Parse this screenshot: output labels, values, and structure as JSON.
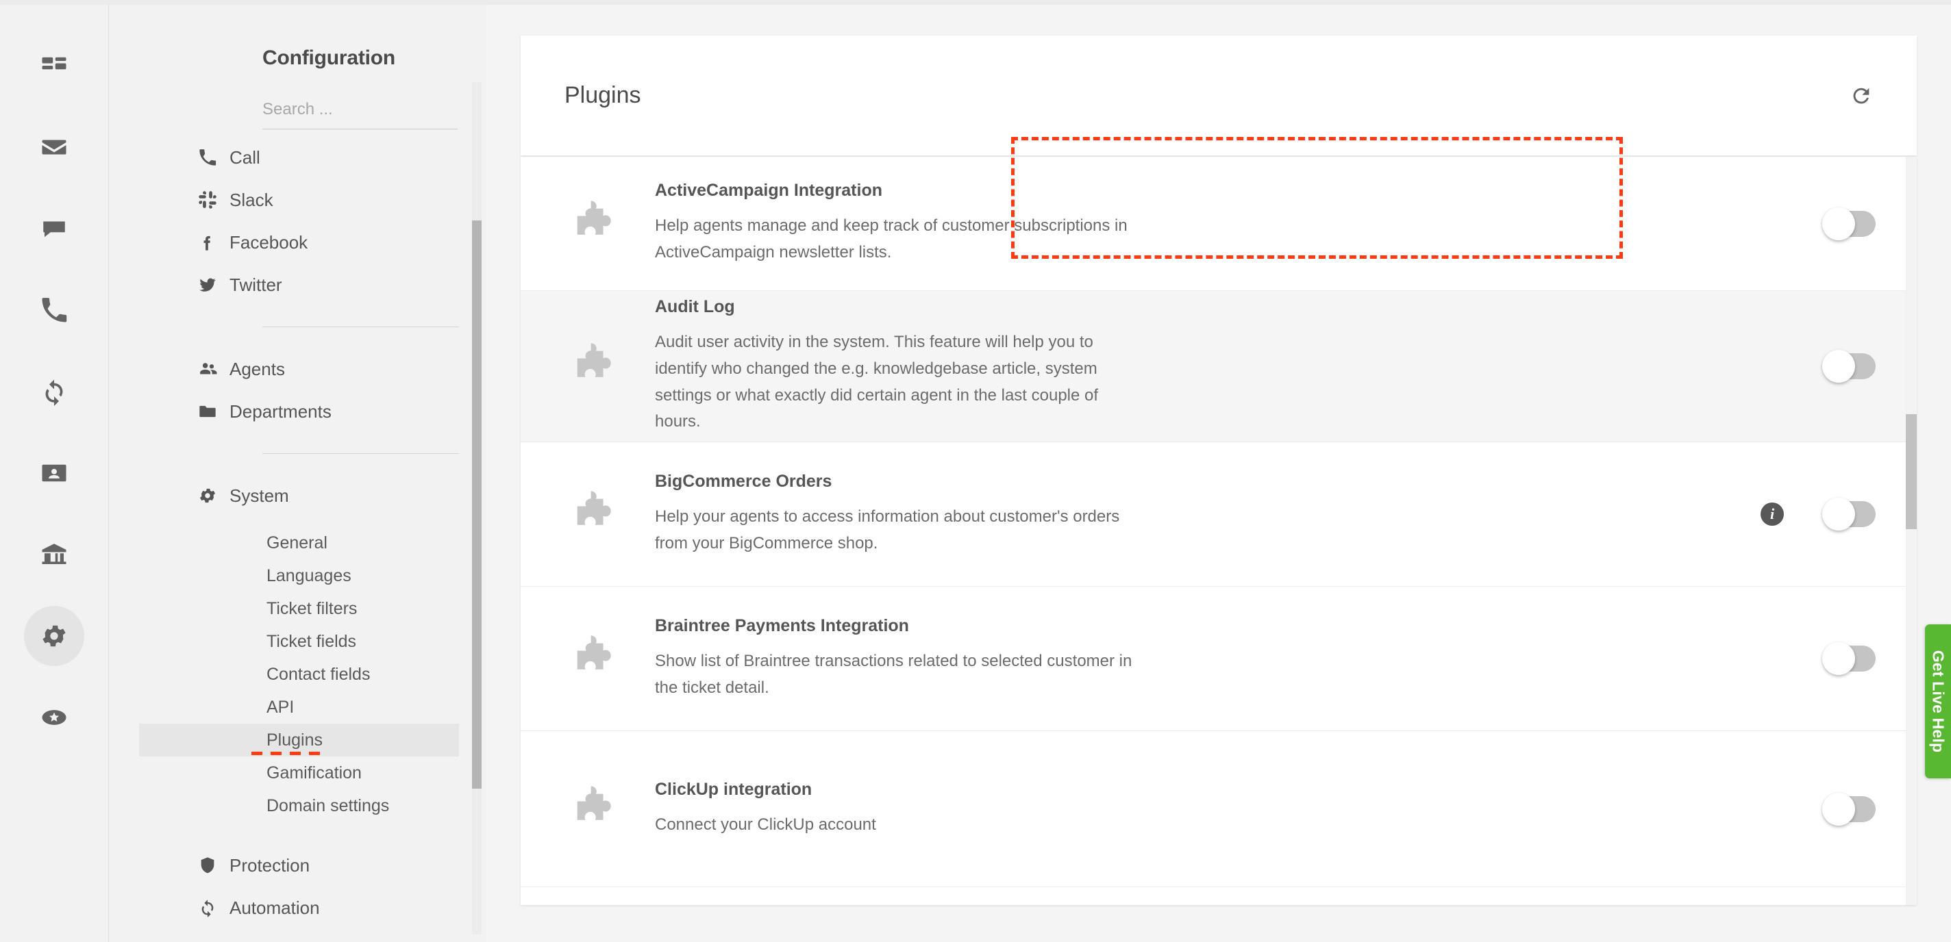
{
  "rail": {
    "items": [
      {
        "name": "dashboard",
        "icon": "dashboard-icon",
        "active": false
      },
      {
        "name": "mail",
        "icon": "envelope-icon",
        "active": false
      },
      {
        "name": "chat",
        "icon": "chat-bubble-icon",
        "active": false
      },
      {
        "name": "calls",
        "icon": "phone-icon",
        "active": false
      },
      {
        "name": "refresh",
        "icon": "circle-arrows-icon",
        "active": false
      },
      {
        "name": "contacts",
        "icon": "contact-card-icon",
        "active": false
      },
      {
        "name": "organizations",
        "icon": "bank-icon",
        "active": false
      },
      {
        "name": "settings",
        "icon": "gear-icon",
        "active": true
      },
      {
        "name": "rewards",
        "icon": "star-badge-icon",
        "active": false
      }
    ]
  },
  "sidebar": {
    "title": "Configuration",
    "search": {
      "value": "",
      "placeholder": "Search ..."
    },
    "channels": [
      {
        "label": "Call",
        "icon": "phone-icon"
      },
      {
        "label": "Slack",
        "icon": "slack-icon"
      },
      {
        "label": "Facebook",
        "icon": "facebook-icon"
      },
      {
        "label": "Twitter",
        "icon": "twitter-icon"
      }
    ],
    "people": [
      {
        "label": "Agents",
        "icon": "people-icon"
      },
      {
        "label": "Departments",
        "icon": "folder-icon"
      }
    ],
    "system": {
      "label": "System",
      "icon": "gear-icon",
      "sub_items": [
        {
          "label": "General",
          "selected": false
        },
        {
          "label": "Languages",
          "selected": false
        },
        {
          "label": "Ticket filters",
          "selected": false
        },
        {
          "label": "Ticket fields",
          "selected": false
        },
        {
          "label": "Contact fields",
          "selected": false
        },
        {
          "label": "API",
          "selected": false
        },
        {
          "label": "Plugins",
          "selected": true
        },
        {
          "label": "Gamification",
          "selected": false
        },
        {
          "label": "Domain settings",
          "selected": false
        }
      ]
    },
    "footer_items": [
      {
        "label": "Protection",
        "icon": "shield-icon"
      },
      {
        "label": "Automation",
        "icon": "circle-arrows-icon"
      }
    ]
  },
  "main": {
    "title": "Plugins",
    "refresh_icon": "refresh-icon",
    "plugins": [
      {
        "name": "ActiveCampaign Integration",
        "description": "Help agents manage and keep track of customer subscriptions in ActiveCampaign newsletter lists.",
        "enabled": false,
        "has_info": false,
        "shaded": false,
        "highlighted": true
      },
      {
        "name": "Audit Log",
        "description": "Audit user activity in the system. This feature will help you to identify who changed the e.g. knowledgebase article, system settings or what exactly did certain agent in the last couple of hours.",
        "enabled": false,
        "has_info": false,
        "shaded": true,
        "highlighted": false
      },
      {
        "name": "BigCommerce Orders",
        "description": "Help your agents to access information about customer's orders from your BigCommerce shop.",
        "enabled": false,
        "has_info": true,
        "shaded": false,
        "highlighted": false
      },
      {
        "name": "Braintree Payments Integration",
        "description": "Show list of Braintree transactions related to selected customer in the ticket detail.",
        "enabled": false,
        "has_info": false,
        "shaded": false,
        "highlighted": false
      },
      {
        "name": "ClickUp integration",
        "description": "Connect your ClickUp account",
        "enabled": false,
        "has_info": false,
        "shaded": false,
        "highlighted": false
      }
    ]
  },
  "live_help": {
    "label": "Get Live Help",
    "color": "#58b832"
  },
  "annotation": {
    "color": "#ff3b14",
    "circle_color": "#f4511e"
  }
}
